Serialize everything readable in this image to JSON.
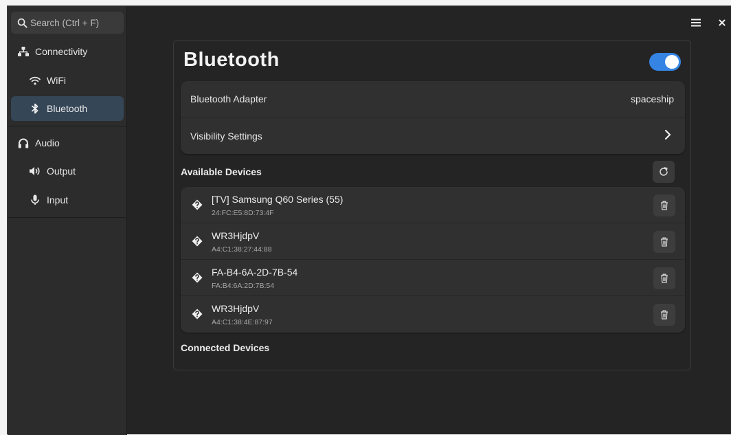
{
  "search": {
    "placeholder": "Search (Ctrl + F)"
  },
  "sidebar": {
    "items": [
      {
        "label": "Connectivity",
        "icon": "network-icon"
      },
      {
        "label": "WiFi",
        "icon": "wifi-icon"
      },
      {
        "label": "Bluetooth",
        "icon": "bluetooth-icon",
        "active": true
      },
      {
        "label": "Audio",
        "icon": "headphones-icon"
      },
      {
        "label": "Output",
        "icon": "speaker-icon"
      },
      {
        "label": "Input",
        "icon": "microphone-icon"
      }
    ]
  },
  "header": {
    "menu_icon": "hamburger-icon",
    "close_icon": "close-icon"
  },
  "main": {
    "title": "Bluetooth",
    "enabled": true,
    "adapter": {
      "label": "Bluetooth Adapter",
      "value": "spaceship"
    },
    "visibility": {
      "label": "Visibility Settings"
    },
    "available_label": "Available Devices",
    "connected_label": "Connected Devices",
    "devices": [
      {
        "name": "[TV] Samsung Q60 Series (55)",
        "address": "24:FC:E5:8D:73:4F"
      },
      {
        "name": "WR3HjdpV",
        "address": "A4:C1:38:27:44:88"
      },
      {
        "name": "FA-B4-6A-2D-7B-54",
        "address": "FA:B4:6A:2D:7B:54"
      },
      {
        "name": "WR3HjdpV",
        "address": "A4:C1:38:4E:87:97"
      }
    ]
  },
  "colors": {
    "accent": "#3584e4",
    "sidebar_active": "#354657",
    "background": "#242424"
  }
}
